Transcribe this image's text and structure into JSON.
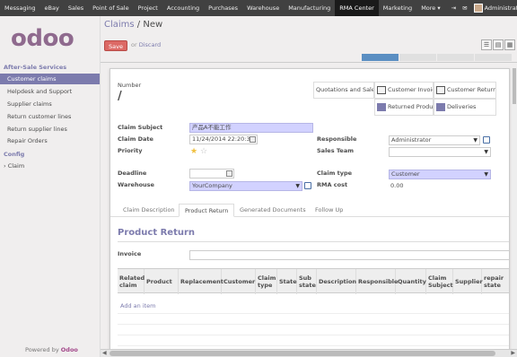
{
  "topnav": {
    "items": [
      "Messaging",
      "eBay",
      "Sales",
      "Point of Sale",
      "Project",
      "Accounting",
      "Purchases",
      "Warehouse",
      "Manufacturing",
      "RMA Center",
      "Marketing",
      "More"
    ],
    "active": "RMA Center",
    "more_caret": "▾",
    "user": "Administrator",
    "user_caret": "▾"
  },
  "logo": {
    "text": "odoo"
  },
  "sidebar": {
    "section1": "After-Sale Services",
    "items1": [
      "Customer claims",
      "Helpdesk and Support",
      "Supplier claims",
      "Return customer lines",
      "Return supplier lines",
      "Repair Orders"
    ],
    "active_item": "Customer claims",
    "section2": "Config",
    "items2": [
      "Claim"
    ],
    "powered_prefix": "Powered by",
    "powered_brand": "Odoo"
  },
  "header": {
    "breadcrumb_parent": "Claims",
    "breadcrumb_sep": " / ",
    "breadcrumb_current": "New",
    "save_label": "Save",
    "or_label": "or",
    "discard_label": "Discard"
  },
  "form": {
    "number_label": "Number",
    "number_value": "/",
    "smart_buttons": [
      "Quotations and Sales",
      "Customer Invoices",
      "Customer Returns",
      "Returned Products",
      "Deliveries"
    ],
    "claim_subject_label": "Claim Subject",
    "claim_subject_value": "产品A不能工作",
    "claim_date_label": "Claim Date",
    "claim_date_value": "11/24/2014 22:20:30",
    "priority_label": "Priority",
    "priority_stars": 2,
    "priority_filled": 1,
    "deadline_label": "Deadline",
    "deadline_value": "",
    "warehouse_label": "Warehouse",
    "warehouse_value": "YourCompany",
    "responsible_label": "Responsible",
    "responsible_value": "Administrator",
    "sales_team_label": "Sales Team",
    "sales_team_value": "",
    "claim_type_label": "Claim type",
    "claim_type_value": "Customer",
    "rma_cost_label": "RMA cost",
    "rma_cost_value": "0.00"
  },
  "tabs": {
    "items": [
      "Claim Description",
      "Product Return",
      "Generated Documents",
      "Follow Up"
    ],
    "active": "Product Return"
  },
  "product_return": {
    "title": "Product Return",
    "invoice_label": "Invoice",
    "invoice_value": "",
    "columns": [
      "Related claim",
      "Product",
      "Replacement",
      "Customer",
      "Claim type",
      "State",
      "Sub state",
      "Description",
      "Responsible",
      "Quantity",
      "Claim Subject",
      "Supplier",
      "repair state"
    ],
    "add_item_label": "Add an item"
  },
  "colors": {
    "topbar": "#414141",
    "accent": "#7c7bad",
    "save": "#dc6965",
    "required_field": "#d2d2ff",
    "brand": "#a24689"
  }
}
